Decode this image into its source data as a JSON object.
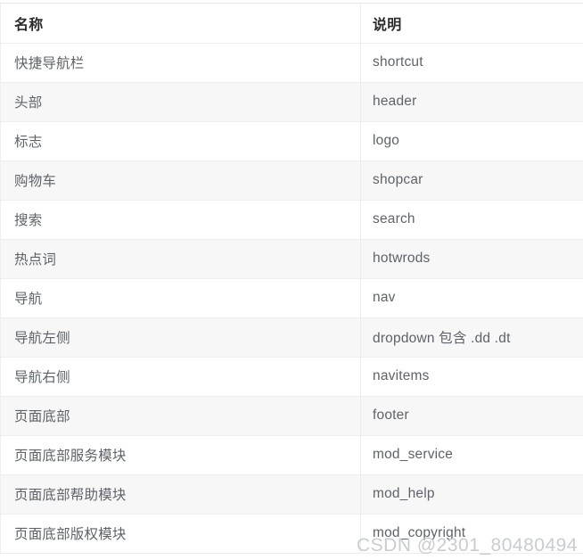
{
  "table": {
    "columns": [
      {
        "key": "name",
        "label": "名称"
      },
      {
        "key": "desc",
        "label": "说明"
      }
    ],
    "rows": [
      {
        "name": "快捷导航栏",
        "desc": "shortcut"
      },
      {
        "name": "头部",
        "desc": "header"
      },
      {
        "name": "标志",
        "desc": "logo"
      },
      {
        "name": "购物车",
        "desc": "shopcar"
      },
      {
        "name": "搜索",
        "desc": "search"
      },
      {
        "name": "热点词",
        "desc": "hotwrods"
      },
      {
        "name": "导航",
        "desc": "nav"
      },
      {
        "name": "导航左侧",
        "desc": "dropdown 包含 .dd .dt"
      },
      {
        "name": "导航右侧",
        "desc": "navitems"
      },
      {
        "name": "页面底部",
        "desc": "footer"
      },
      {
        "name": "页面底部服务模块",
        "desc": "mod_service"
      },
      {
        "name": "页面底部帮助模块",
        "desc": "mod_help"
      },
      {
        "name": "页面底部版权模块",
        "desc": "mod_copyright"
      }
    ]
  },
  "watermark": {
    "text": "CSDN @2301_80480494"
  },
  "colors": {
    "header_text": "#2b2b2b",
    "body_text": "#5f6368",
    "row_alt_background": "#f7f7f7",
    "row_background": "#ffffff",
    "border": "#ededed",
    "watermark_text": "#c9ccd1"
  }
}
